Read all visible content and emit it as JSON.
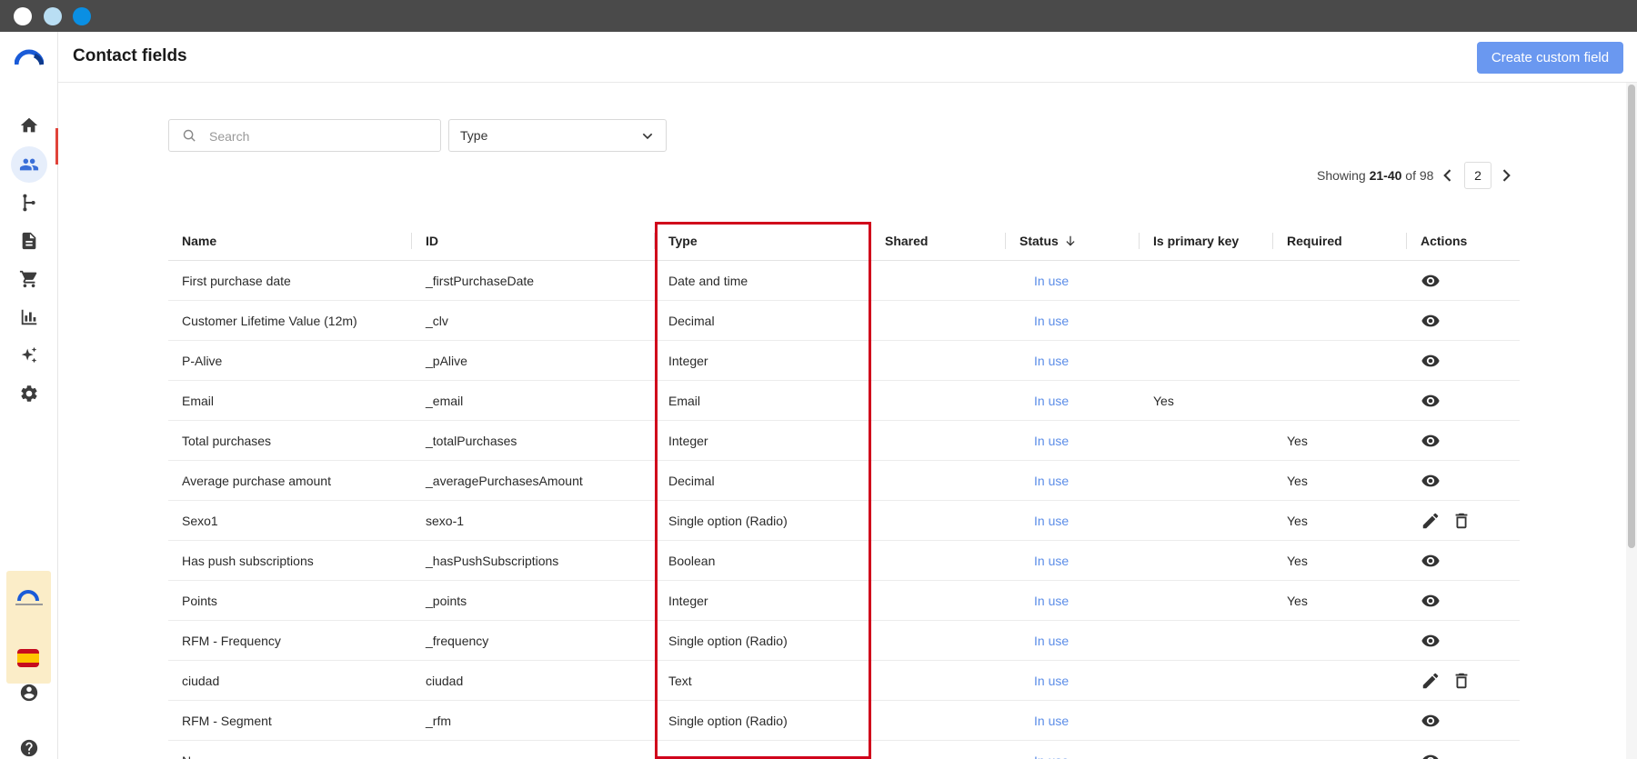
{
  "header": {
    "title": "Contact fields",
    "create_button": "Create custom field"
  },
  "filters": {
    "search_placeholder": "Search",
    "type_label": "Type"
  },
  "pagination": {
    "prefix": "Showing ",
    "range": "21-40",
    "suffix": " of 98",
    "page": "2"
  },
  "table": {
    "columns": {
      "name": "Name",
      "id": "ID",
      "type": "Type",
      "shared": "Shared",
      "status": "Status",
      "primary_key": "Is primary key",
      "required": "Required",
      "actions": "Actions"
    },
    "rows": [
      {
        "name": "First purchase date",
        "id": "_firstPurchaseDate",
        "type": "Date and time",
        "status": "In use",
        "primary_key": "",
        "required": "",
        "actions": "view"
      },
      {
        "name": "Customer Lifetime Value (12m)",
        "id": "_clv",
        "type": "Decimal",
        "status": "In use",
        "primary_key": "",
        "required": "",
        "actions": "view"
      },
      {
        "name": "P-Alive",
        "id": "_pAlive",
        "type": "Integer",
        "status": "In use",
        "primary_key": "",
        "required": "",
        "actions": "view"
      },
      {
        "name": "Email",
        "id": "_email",
        "type": "Email",
        "status": "In use",
        "primary_key": "Yes",
        "required": "",
        "actions": "view"
      },
      {
        "name": "Total purchases",
        "id": "_totalPurchases",
        "type": "Integer",
        "status": "In use",
        "primary_key": "",
        "required": "Yes",
        "actions": "view"
      },
      {
        "name": "Average purchase amount",
        "id": "_averagePurchasesAmount",
        "type": "Decimal",
        "status": "In use",
        "primary_key": "",
        "required": "Yes",
        "actions": "view"
      },
      {
        "name": "Sexo1",
        "id": "sexo-1",
        "type": "Single option (Radio)",
        "status": "In use",
        "primary_key": "",
        "required": "Yes",
        "actions": "edit"
      },
      {
        "name": "Has push subscriptions",
        "id": "_hasPushSubscriptions",
        "type": "Boolean",
        "status": "In use",
        "primary_key": "",
        "required": "Yes",
        "actions": "view"
      },
      {
        "name": "Points",
        "id": "_points",
        "type": "Integer",
        "status": "In use",
        "primary_key": "",
        "required": "Yes",
        "actions": "view"
      },
      {
        "name": "RFM - Frequency",
        "id": "_frequency",
        "type": "Single option (Radio)",
        "status": "In use",
        "primary_key": "",
        "required": "",
        "actions": "view"
      },
      {
        "name": "ciudad",
        "id": "ciudad",
        "type": "Text",
        "status": "In use",
        "primary_key": "",
        "required": "",
        "actions": "edit"
      },
      {
        "name": "RFM - Segment",
        "id": "_rfm",
        "type": "Single option (Radio)",
        "status": "In use",
        "primary_key": "",
        "required": "",
        "actions": "view"
      },
      {
        "name": "N",
        "id": "",
        "type": "",
        "status": "In use",
        "primary_key": "",
        "required": "",
        "actions": "view"
      }
    ]
  },
  "sidebar": {
    "items": [
      "home-icon",
      "contacts-icon",
      "automation-icon",
      "document-icon",
      "cart-icon",
      "analytics-icon",
      "ai-sparkle-icon",
      "settings-icon"
    ],
    "bottom": [
      "account-icon",
      "help-icon"
    ]
  },
  "colors": {
    "accent": "#6a98f0",
    "status_link": "#5b8de8",
    "highlight": "#d0021b",
    "titlebar": "#4a4a4a"
  }
}
